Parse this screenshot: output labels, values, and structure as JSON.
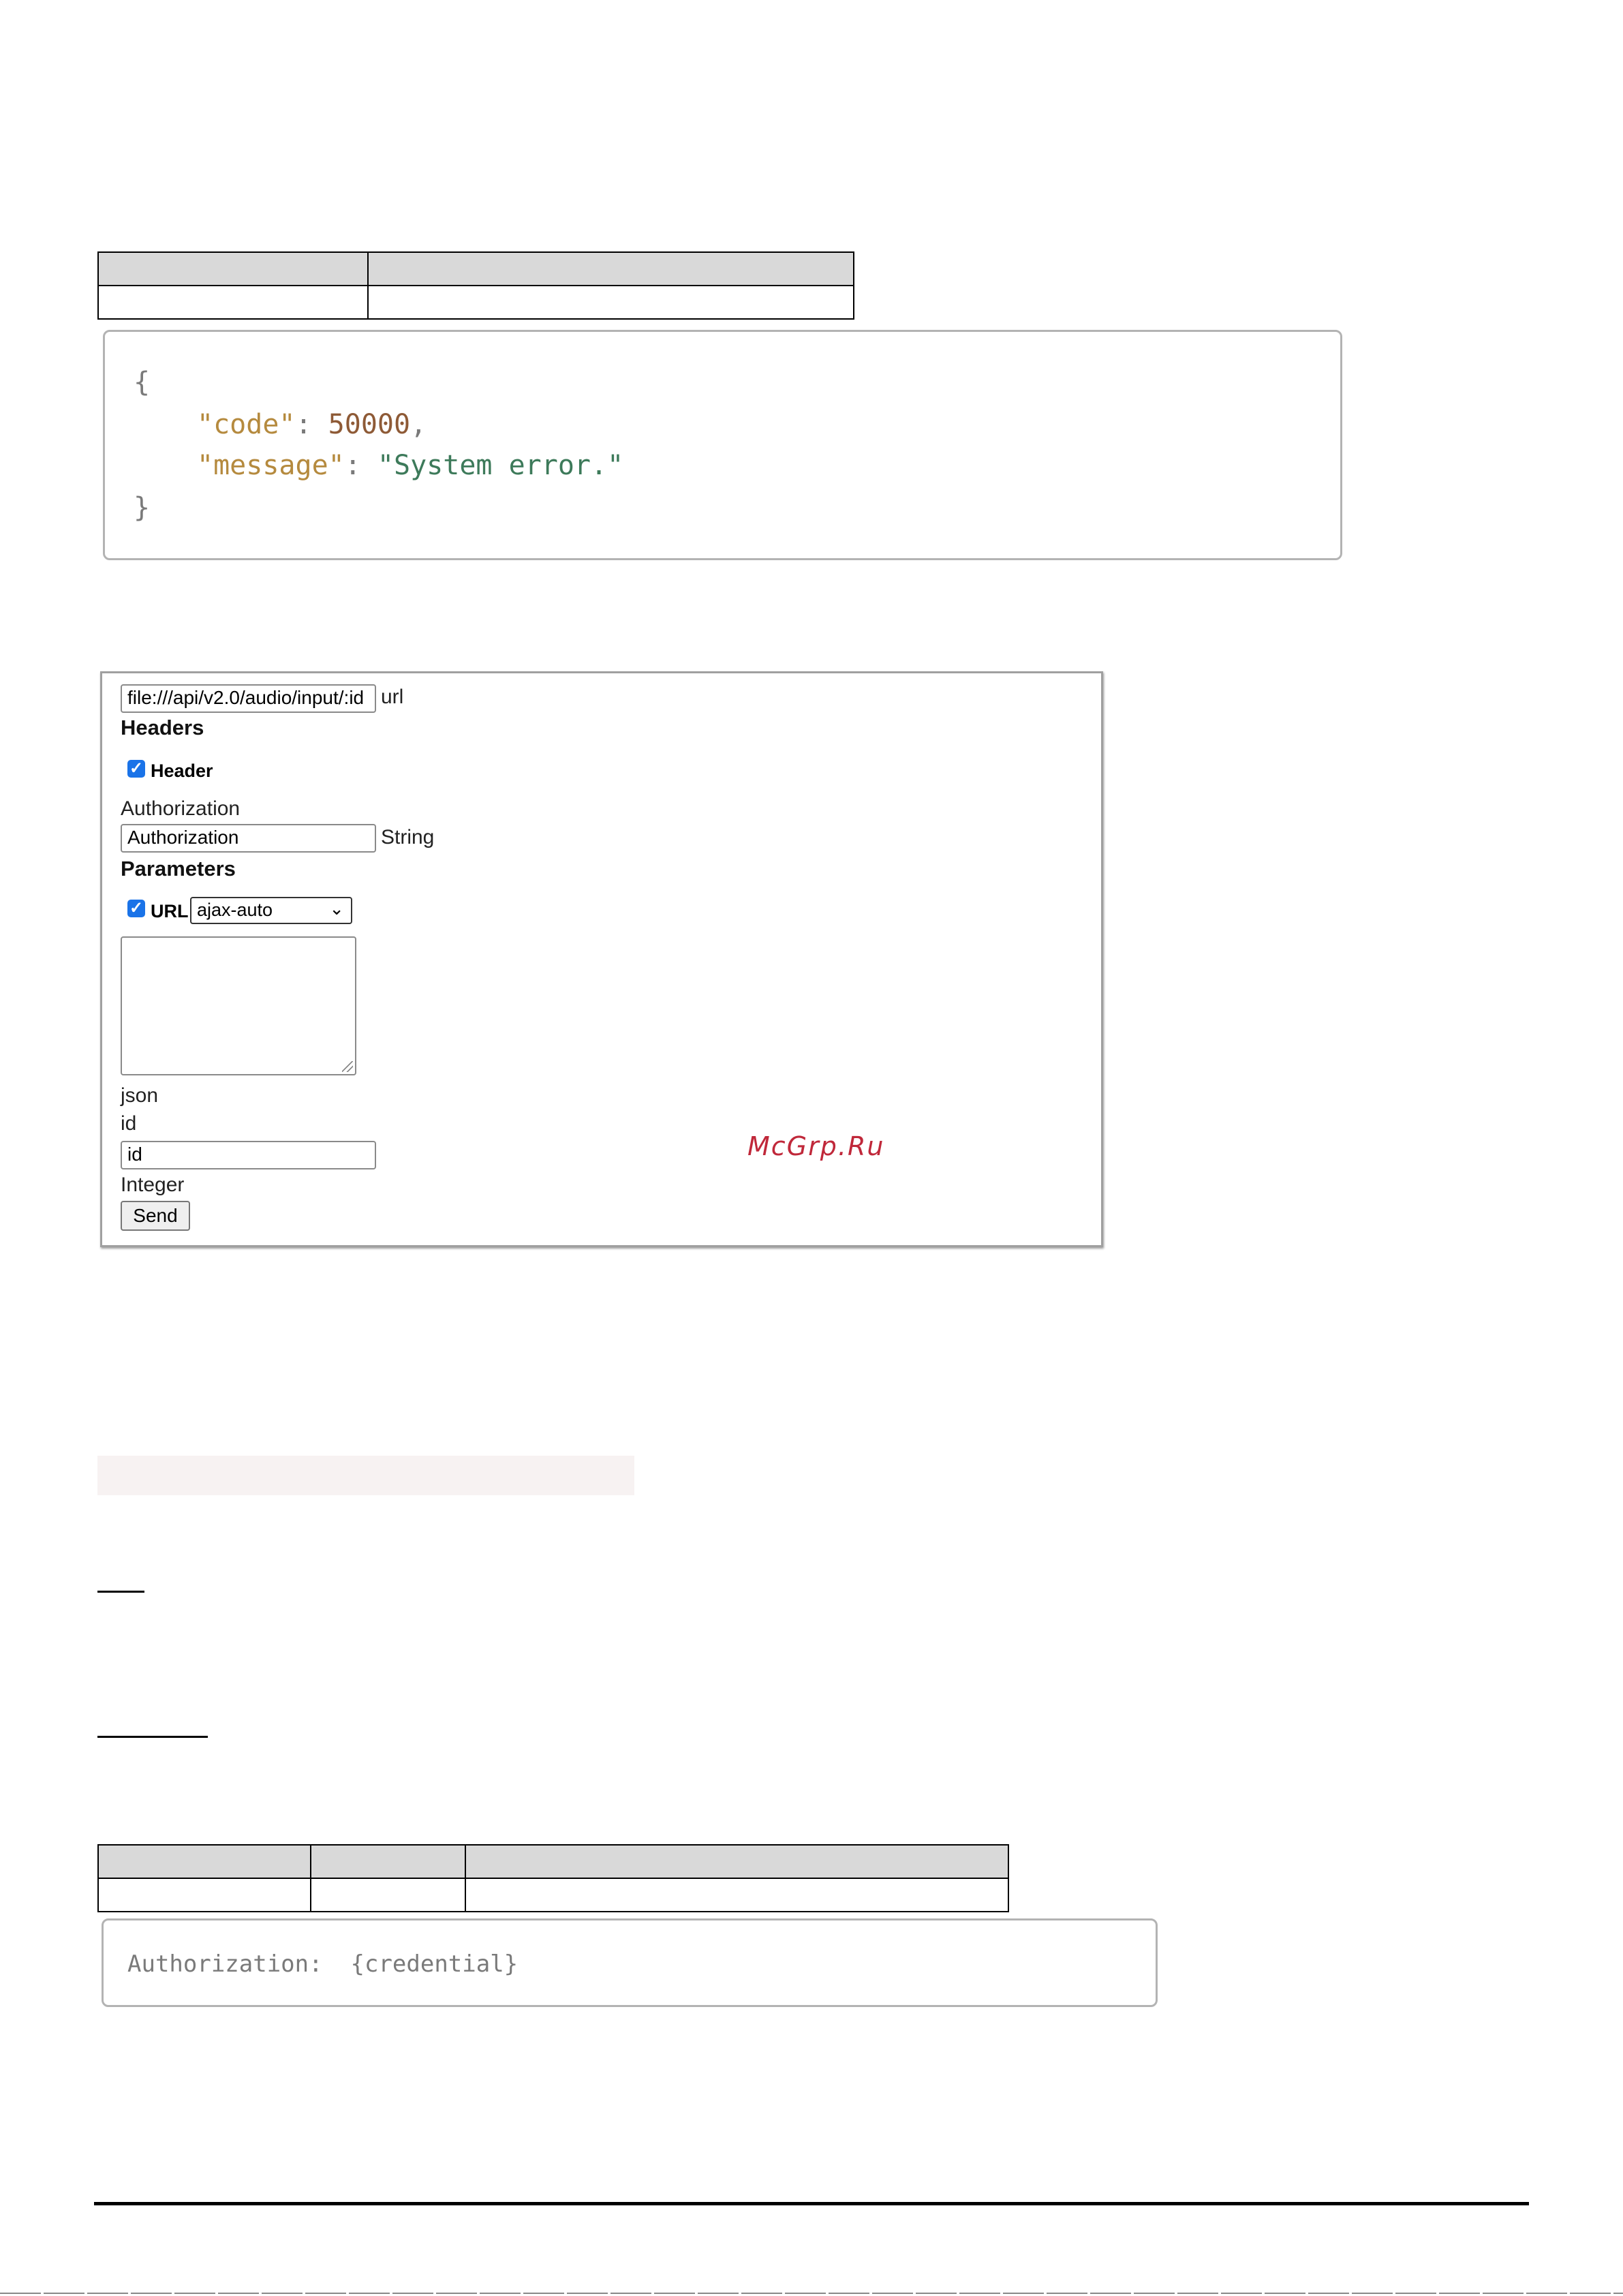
{
  "response_code_block": {
    "open_brace": "{",
    "code_key": "\"code\"",
    "code_value": "50000",
    "message_key": "\"message\"",
    "message_value": "\"System error.\"",
    "close_brace": "}"
  },
  "demo_form": {
    "url_value": "file:///api/v2.0/audio/input/:id",
    "url_label": "url",
    "headers_heading": "Headers",
    "header_checkbox_label": "Header",
    "auth_label": "Authorization",
    "auth_value": "Authorization",
    "auth_type": "String",
    "parameters_heading": "Parameters",
    "url_checkbox_label": "URL",
    "select_value": "ajax-auto",
    "json_label": "json",
    "id_label": "id",
    "id_value": "id",
    "id_type": "Integer",
    "send_button": "Send"
  },
  "watermark": "McGrp.Ru",
  "auth_code_block": {
    "text": "Authorization:  {credential}"
  },
  "colors": {
    "table_header": "#d9d9d9",
    "code_border": "#b3b3b3",
    "json_key": "#b58a3e",
    "json_string": "#3d7a5a",
    "watermark": "#c0283a"
  }
}
